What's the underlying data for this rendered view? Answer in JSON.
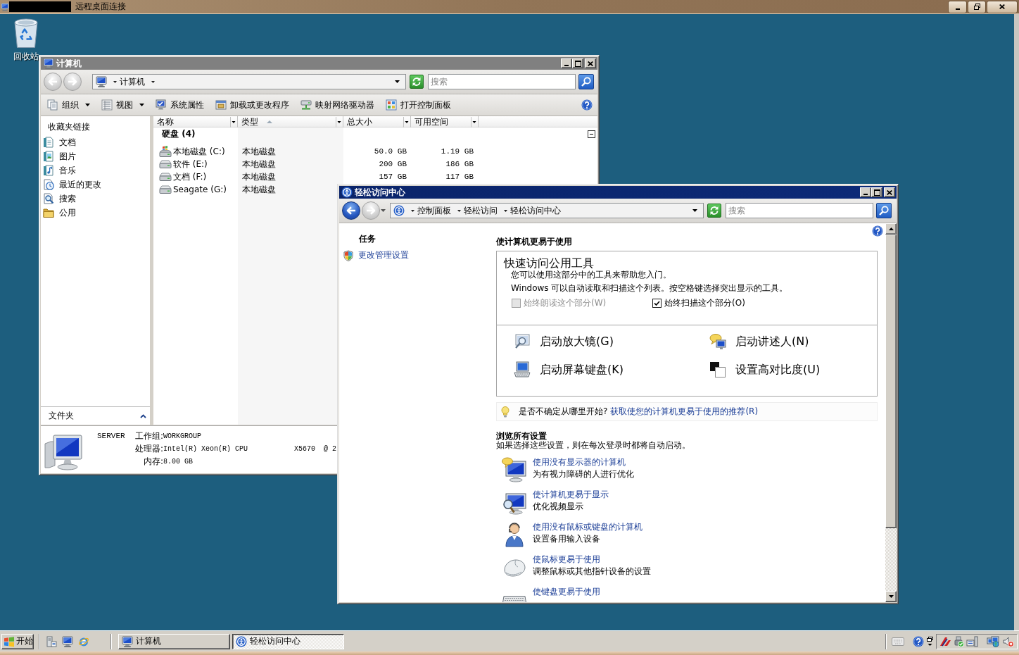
{
  "remote_desktop": {
    "title": "远程桌面连接"
  },
  "desktop_icons": [
    {
      "label": "回收站"
    }
  ],
  "computer_window": {
    "title": "计算机",
    "active": false,
    "back": {
      "disabled": true
    },
    "forward": {
      "disabled": true
    },
    "history_menu": false,
    "address": [
      {
        "label": "计算机",
        "menu": true
      }
    ],
    "search": {
      "placeholder": "搜索"
    },
    "toolbar": [
      {
        "label": "组织",
        "dropdown": true
      },
      {
        "label": "视图",
        "dropdown": true
      },
      {
        "label": "系统属性",
        "dropdown": false
      },
      {
        "label": "卸载或更改程序",
        "dropdown": false
      },
      {
        "label": "映射网络驱动器",
        "dropdown": false
      },
      {
        "label": "打开控制面板",
        "dropdown": false
      }
    ],
    "favorites": {
      "title": "收藏夹链接",
      "items": [
        {
          "label": "文档"
        },
        {
          "label": "图片"
        },
        {
          "label": "音乐"
        },
        {
          "label": "最近的更改"
        },
        {
          "label": "搜索"
        },
        {
          "label": "公用"
        }
      ]
    },
    "folders": {
      "label": "文件夹"
    },
    "table": {
      "columns": [
        {
          "label": "名称",
          "sorted": false
        },
        {
          "label": "类型",
          "sorted": true
        },
        {
          "label": "总大小",
          "sorted": false
        },
        {
          "label": "可用空间",
          "sorted": false
        }
      ],
      "group": "硬盘 (4)",
      "rows": [
        {
          "kind": "system",
          "name": "本地磁盘 (C:)",
          "type": "本地磁盘",
          "total": "50.0 GB",
          "free": "1.19 GB"
        },
        {
          "kind": "drive",
          "name": "软件 (E:)",
          "type": "本地磁盘",
          "total": "200 GB",
          "free": "186 GB"
        },
        {
          "kind": "drive",
          "name": "文档 (F:)",
          "type": "本地磁盘",
          "total": "157 GB",
          "free": "117 GB"
        },
        {
          "kind": "drive",
          "name": "Seagate (G:)",
          "type": "本地磁盘"
        }
      ]
    },
    "details": {
      "name": "SERVER",
      "fields": [
        {
          "label": "工作组:",
          "value": "WORKGROUP"
        },
        {
          "label": "处理器:",
          "value": "Intel(R) Xeon(R) CPU           X5670  @ 2"
        },
        {
          "label": "内存:",
          "value": "8.00 GB"
        }
      ]
    }
  },
  "ease_window": {
    "title": "轻松访问中心",
    "active": true,
    "back": {
      "disabled": false
    },
    "forward": {
      "disabled": true
    },
    "history_menu": true,
    "address": [
      {
        "label": "控制面板",
        "menu": true
      },
      {
        "label": "轻松访问",
        "menu": true
      },
      {
        "label": "轻松访问中心",
        "menu": false
      }
    ],
    "search": {
      "placeholder": "搜索"
    },
    "tasks": {
      "title": "任务",
      "links": [
        {
          "label": "更改管理设置"
        }
      ]
    },
    "heading": "使计算机更易于使用",
    "quick_access": {
      "title": "快速访问公用工具",
      "lines": [
        "您可以使用这部分中的工具来帮助您入门。",
        "Windows 可以自动读取和扫描这个列表。按空格键选择突出显示的工具。"
      ],
      "options": [
        {
          "label": "始终朗读这个部分(W)",
          "checked": false,
          "disabled": true
        },
        {
          "label": "始终扫描这个部分(O)",
          "checked": true,
          "disabled": false
        }
      ],
      "tools": [
        {
          "label": "启动放大镜(G)"
        },
        {
          "label": "启动讲述人(N)"
        },
        {
          "label": "启动屏幕键盘(K)"
        },
        {
          "label": "设置高对比度(U)"
        }
      ]
    },
    "tip": {
      "text": "是否不确定从哪里开始?",
      "link": "获取使您的计算机更易于使用的推荐(R)"
    },
    "browse": {
      "title": "浏览所有设置",
      "subtitle": "如果选择这些设置，则在每次登录时都将自动启动。",
      "items": [
        {
          "link": "使用没有显示器的计算机",
          "description": "为有视力障碍的人进行优化"
        },
        {
          "link": "使计算机更易于显示",
          "description": "优化视频显示"
        },
        {
          "link": "使用没有鼠标或键盘的计算机",
          "description": "设置备用输入设备"
        },
        {
          "link": "使鼠标更易于使用",
          "description": "调整鼠标或其他指针设备的设置"
        },
        {
          "link": "使键盘更易于使用"
        }
      ]
    }
  },
  "taskbar": {
    "start": "开始",
    "tasks": [
      {
        "label": "计算机",
        "selected": false
      },
      {
        "label": "轻松访问中心",
        "selected": true
      }
    ]
  }
}
